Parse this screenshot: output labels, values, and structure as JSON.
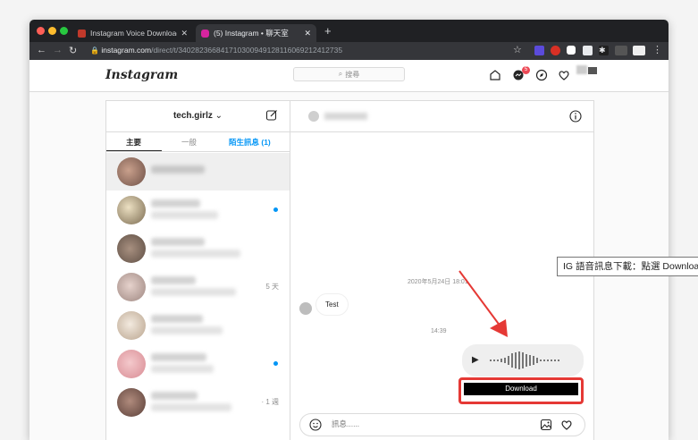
{
  "browser": {
    "tabs": [
      {
        "title": "Instagram Voice Downloader -",
        "active": false
      },
      {
        "title": "(5) Instagram • 聊天室",
        "active": true
      }
    ],
    "url_host": "instagram.com",
    "url_path": "/direct/t/340282366841710300949128116069212412735"
  },
  "ig": {
    "logo": "Instagram",
    "search_placeholder": "搜尋",
    "notification_count": "5"
  },
  "inbox": {
    "account": "tech.girlz",
    "tabs": [
      "主要",
      "一般",
      "陌生訊息 (1)"
    ],
    "conversations": [
      {
        "meta": "",
        "unread": false,
        "selected": true
      },
      {
        "meta": "",
        "unread": true,
        "selected": false
      },
      {
        "meta": "",
        "unread": false,
        "selected": false
      },
      {
        "meta": "5 天",
        "unread": false,
        "selected": false
      },
      {
        "meta": "",
        "unread": false,
        "selected": false
      },
      {
        "meta": "",
        "unread": true,
        "selected": false
      },
      {
        "meta": "· 1 週",
        "unread": false,
        "selected": false
      }
    ]
  },
  "chat": {
    "date_stamp": "2020年5月24日 18:01",
    "message_text": "Test",
    "time_stamp": "14:39",
    "download_label": "Download",
    "input_placeholder": "訊息......"
  },
  "annotation": {
    "tooltip": "IG 語音訊息下載：點選 Download"
  },
  "colors": {
    "highlight": "#e53935",
    "unread": "#0095f6",
    "badge": "#ed4956"
  }
}
